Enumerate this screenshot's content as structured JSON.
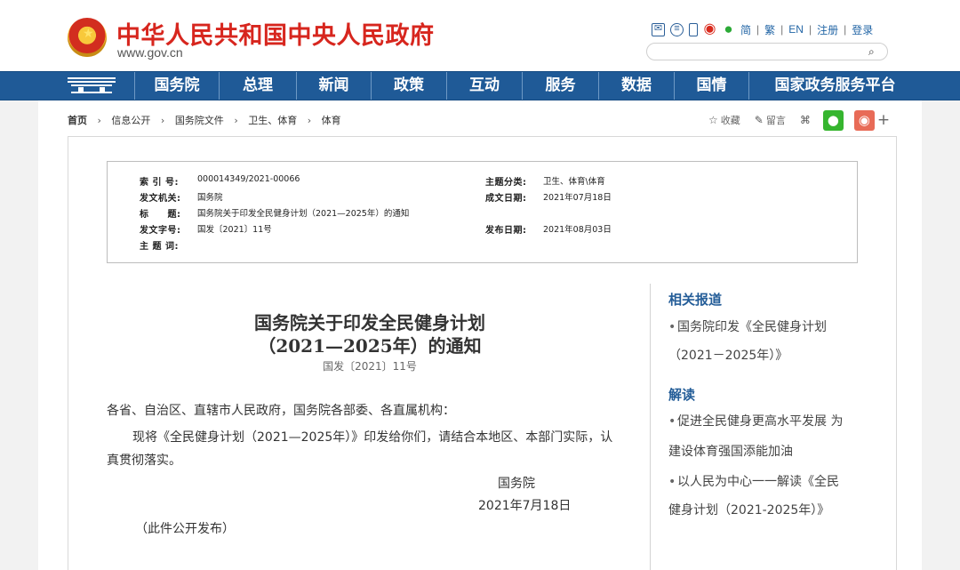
{
  "header": {
    "site_title": "中华人民共和国中央人民政府",
    "site_url": "www.gov.cn",
    "tools": {
      "simplified": "简",
      "traditional": "繁",
      "english": "EN",
      "register": "注册",
      "login": "登录"
    },
    "search": {
      "placeholder": ""
    },
    "icons": [
      "mail-icon",
      "rss-icon",
      "mobile-icon",
      "weibo-icon",
      "wechat-icon",
      "search-icon"
    ]
  },
  "nav": {
    "items": [
      "国务院",
      "总理",
      "新闻",
      "政策",
      "互动",
      "服务",
      "数据",
      "国情",
      "国家政务服务平台"
    ]
  },
  "breadcrumb": {
    "items": [
      "首页",
      "信息公开",
      "国务院文件",
      "卫生、体育",
      "体育"
    ]
  },
  "actions": {
    "favorite": "收藏",
    "comment": "留言",
    "plus": "+"
  },
  "metadata": {
    "index_label": "索 引 号:",
    "index_value": "000014349/2021-00066",
    "issuer_label": "发文机关:",
    "issuer_value": "国务院",
    "title_label": "标　　题:",
    "title_value": "国务院关于印发全民健身计划（2021—2025年）的通知",
    "doc_no_label": "发文字号:",
    "doc_no_value": "国发〔2021〕11号",
    "subject_label": "主 题 词:",
    "subject_value": "",
    "category_label": "主题分类:",
    "category_value": "卫生、体育\\体育",
    "written_date_label": "成文日期:",
    "written_date_value": "2021年07月18日",
    "published_date_label": "发布日期:",
    "published_date_value": "2021年08月03日"
  },
  "article": {
    "title_line_1": "国务院关于印发全民健身计划",
    "title_line_2": "（2021—2025年）的通知",
    "document_number": "国发〔2021〕11号",
    "recipients": "各省、自治区、直辖市人民政府，国务院各部委、各直属机构：",
    "body_line_1": "现将《全民健身计划（2021—2025年）》印发给你们，请结合本地区、本部门实际，认",
    "body_line_2": "真贯彻落实。",
    "signature": "国务院",
    "date": "2021年7月18日",
    "publication_note": "（此件公开发布）"
  },
  "sidebar": {
    "related_title": "相关报道",
    "related_link_line_1": "国务院印发《全民健身计划",
    "related_link_line_2": "（2021－2025年）》",
    "interpretation_title": "解读",
    "interpretation_1_line_1": "促进全民健身更高水平发展 为",
    "interpretation_1_line_2": "建设体育强国添能加油",
    "interpretation_2_line_1": "以人民为中心一一解读《全民",
    "interpretation_2_line_2": "健身计划（2021-2025年）》"
  },
  "colors": {
    "brand_red": "#d7261e",
    "nav_blue": "#1f5a97",
    "link_blue": "#245d98",
    "wechat_green": "#36b52f",
    "weibo_orange": "#e86b57"
  }
}
